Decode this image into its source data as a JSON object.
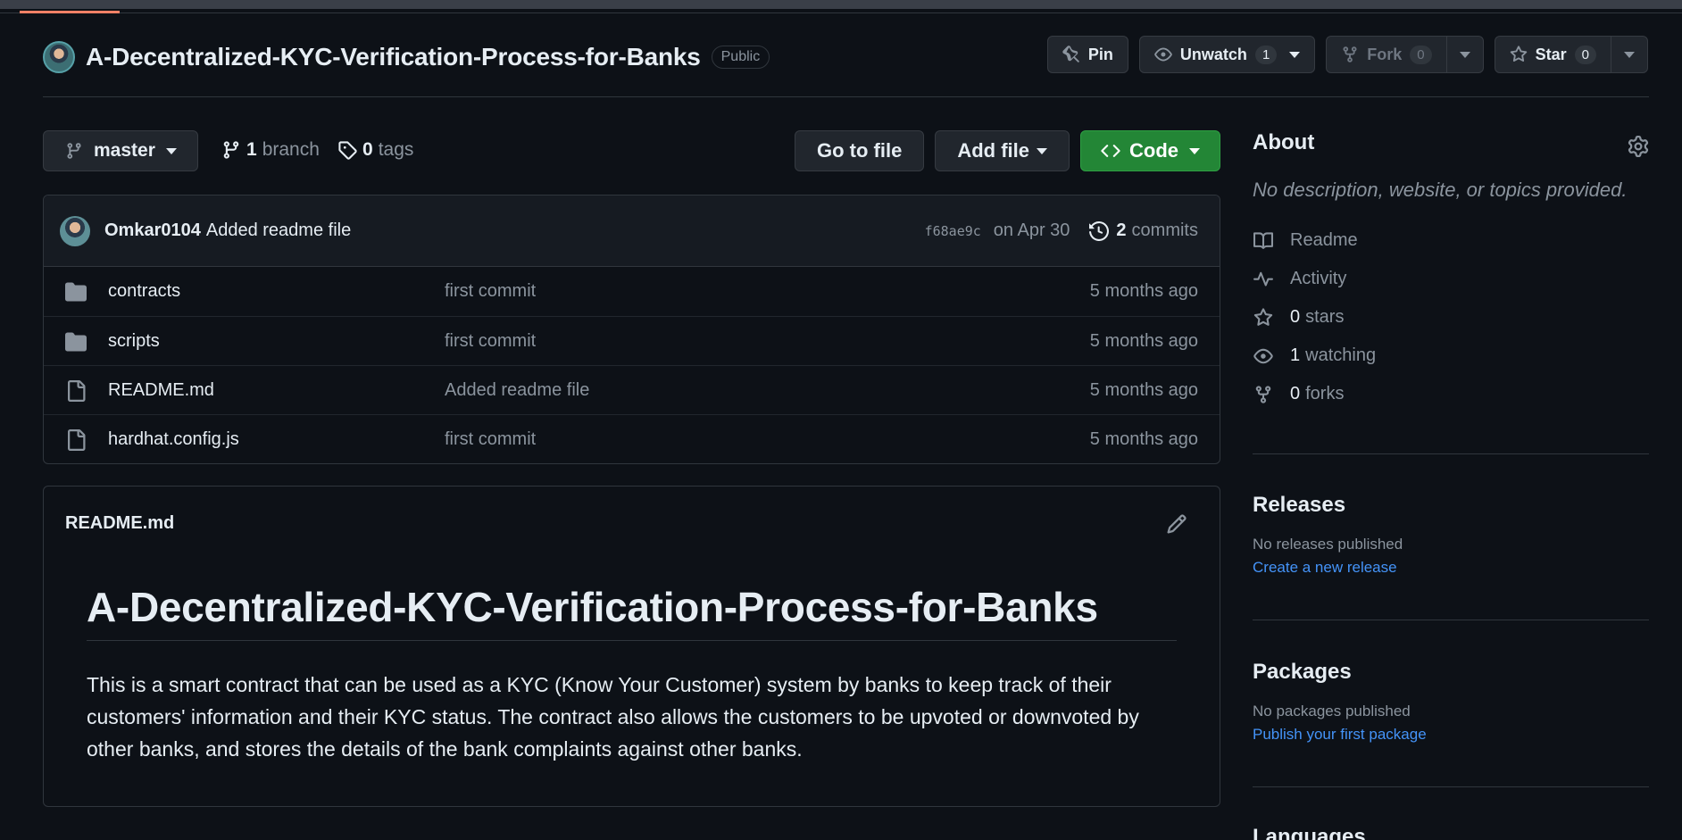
{
  "repo": {
    "name": "A-Decentralized-KYC-Verification-Process-for-Banks",
    "visibility": "Public"
  },
  "header_actions": {
    "pin": "Pin",
    "watch": "Unwatch",
    "watch_count": "1",
    "fork": "Fork",
    "fork_count": "0",
    "star": "Star",
    "star_count": "0"
  },
  "branch_bar": {
    "branch": "master",
    "branch_count": "1",
    "branch_label": "branch",
    "tag_count": "0",
    "tag_label": "tags",
    "go_to_file": "Go to file",
    "add_file": "Add file",
    "code": "Code"
  },
  "latest_commit": {
    "author": "Omkar0104",
    "message": "Added readme file",
    "sha": "f68ae9c",
    "date": "on Apr 30",
    "commit_count": "2",
    "commit_label": "commits"
  },
  "files": [
    {
      "name": "contracts",
      "type": "folder",
      "commit": "first commit",
      "age": "5 months ago"
    },
    {
      "name": "scripts",
      "type": "folder",
      "commit": "first commit",
      "age": "5 months ago"
    },
    {
      "name": "README.md",
      "type": "file",
      "commit": "Added readme file",
      "age": "5 months ago"
    },
    {
      "name": "hardhat.config.js",
      "type": "file",
      "commit": "first commit",
      "age": "5 months ago"
    }
  ],
  "readme": {
    "filename": "README.md",
    "heading": "A-Decentralized-KYC-Verification-Process-for-Banks",
    "body": "This is a smart contract that can be used as a KYC (Know Your Customer) system by banks to keep track of their customers' information and their KYC status. The contract also allows the customers to be upvoted or downvoted by other banks, and stores the details of the bank complaints against other banks."
  },
  "sidebar": {
    "about_title": "About",
    "about_desc": "No description, website, or topics provided.",
    "links": [
      {
        "icon": "book-icon",
        "count": "",
        "label": "Readme"
      },
      {
        "icon": "pulse-icon",
        "count": "",
        "label": "Activity"
      },
      {
        "icon": "star-icon",
        "count": "0",
        "label": "stars"
      },
      {
        "icon": "eye-icon",
        "count": "1",
        "label": "watching"
      },
      {
        "icon": "fork-icon",
        "count": "0",
        "label": "forks"
      }
    ],
    "releases_title": "Releases",
    "releases_empty": "No releases published",
    "releases_link": "Create a new release",
    "packages_title": "Packages",
    "packages_empty": "No packages published",
    "packages_link": "Publish your first package",
    "languages_title": "Languages"
  },
  "colors": {
    "background": "#0d1117",
    "accent_green": "#238636",
    "link_blue": "#4493f8",
    "muted": "#8b949e"
  }
}
